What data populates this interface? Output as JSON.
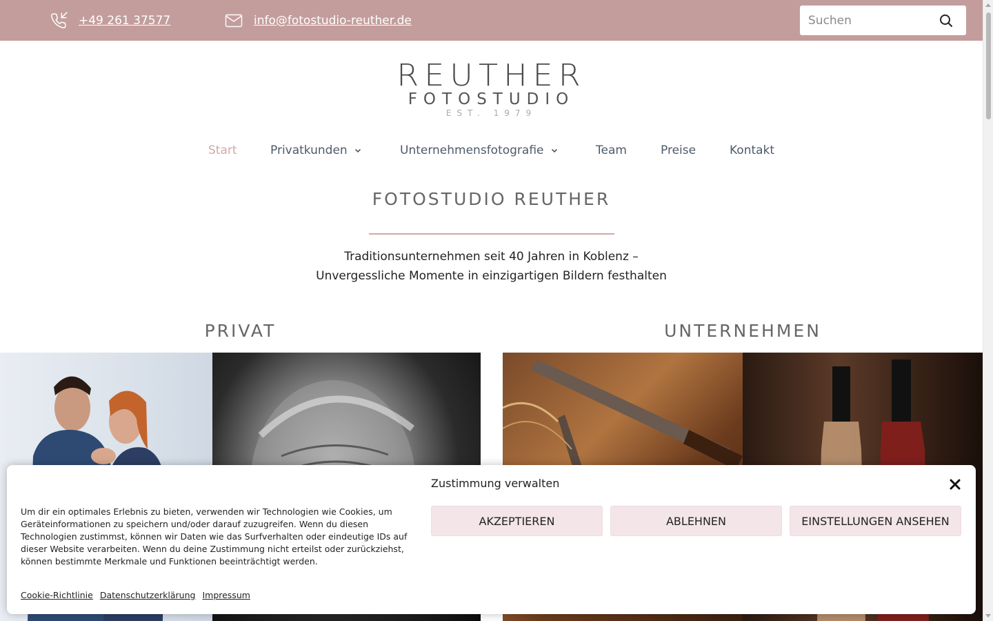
{
  "topbar": {
    "phone": "+49 261 37577",
    "email": "info@fotostudio-reuther.de",
    "search_placeholder": "Suchen",
    "icons": [
      "phone-incoming-icon",
      "mail-icon",
      "search-icon"
    ]
  },
  "logo": {
    "line1": "REUTHER",
    "line2": "FOTOSTUDIO",
    "line3": "EST. 1979"
  },
  "nav": {
    "items": [
      {
        "label": "Start",
        "active": true
      },
      {
        "label": "Privatkunden",
        "dropdown": true
      },
      {
        "label": "Unternehmensfotografie",
        "dropdown": true
      },
      {
        "label": "Team"
      },
      {
        "label": "Preise"
      },
      {
        "label": "Kontakt"
      }
    ]
  },
  "main": {
    "title": "FOTOSTUDIO REUTHER",
    "tagline_line1": "Traditionsunternehmen seit 40 Jahren in Koblenz –",
    "tagline_line2": "Unvergessliche Momente in einzigartigen Bildern festhalten",
    "col_left": "PRIVAT",
    "col_right": "UNTERNEHMEN"
  },
  "cookie": {
    "title": "Zustimmung verwalten",
    "text": "Um dir ein optimales Erlebnis zu bieten, verwenden wir Technologien wie Cookies, um Geräteinformationen zu speichern und/oder darauf zuzugreifen. Wenn du diesen Technologien zustimmst, können wir Daten wie das Surfverhalten oder eindeutige IDs auf dieser Website verarbeiten. Wenn du deine Zustimmung nicht erteilst oder zurückziehst, können bestimmte Merkmale und Funktionen beeinträchtigt werden.",
    "accept": "AKZEPTIEREN",
    "deny": "ABLEHNEN",
    "settings": "EINSTELLUNGEN ANSEHEN",
    "links": [
      "Cookie-Richtlinie",
      "Datenschutzerklärung",
      "Impressum"
    ]
  },
  "colors": {
    "topbar": "#c39d9c",
    "accent": "#d4a7a6",
    "button_bg": "#f3e5e8"
  }
}
